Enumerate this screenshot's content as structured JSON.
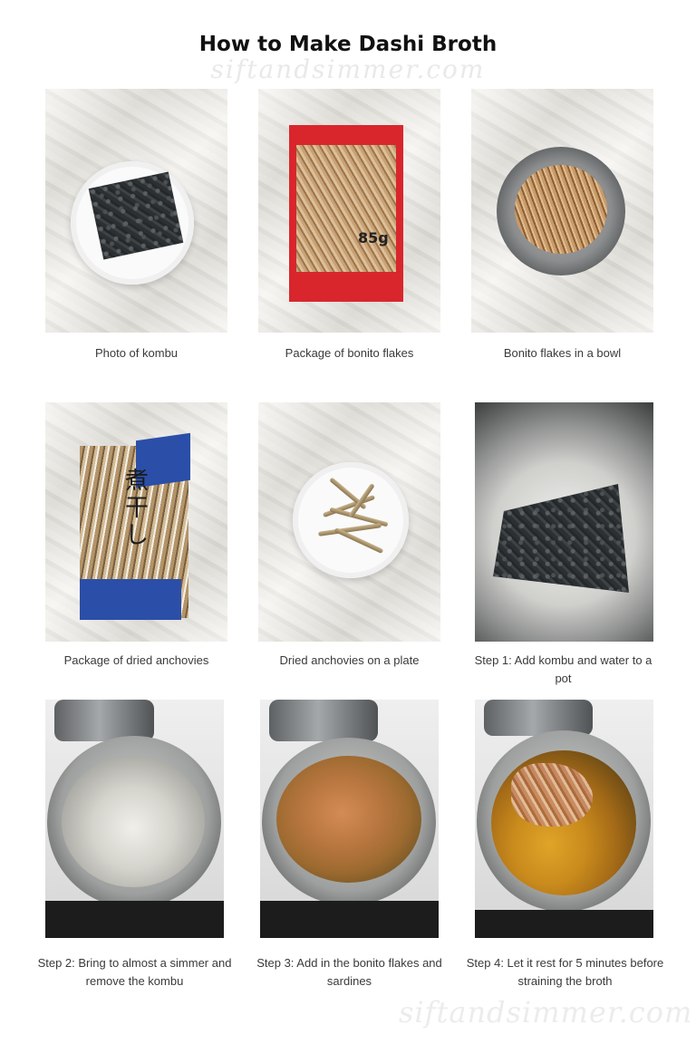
{
  "title": "How to Make Dashi Broth",
  "watermark": "siftandsimmer.com",
  "photos": [
    {
      "caption": "Photo of kombu"
    },
    {
      "caption": "Package of bonito flakes",
      "label": "85g"
    },
    {
      "caption": "Bonito flakes in a bowl"
    },
    {
      "caption": "Package of dried anchovies",
      "label": "煮干し"
    },
    {
      "caption": "Dried anchovies on a plate"
    },
    {
      "caption": "Step 1: Add kombu and water to a pot"
    },
    {
      "caption": "Step 2: Bring to almost a simmer and remove the kombu"
    },
    {
      "caption": "Step 3: Add in the bonito flakes and sardines"
    },
    {
      "caption": "Step 4: Let it rest for 5 minutes before straining the broth"
    }
  ]
}
